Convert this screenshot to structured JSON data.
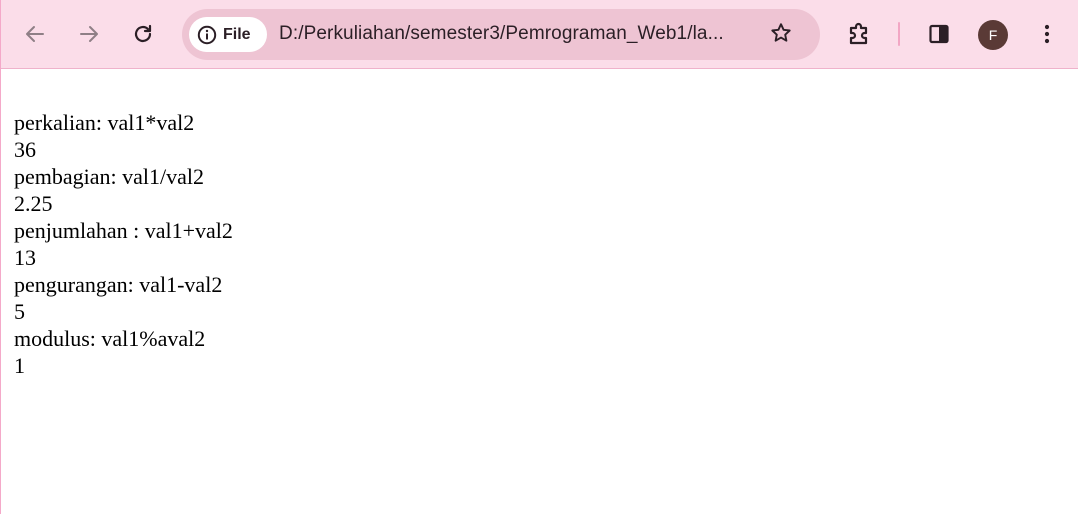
{
  "toolbar": {
    "back_icon": "arrow-left-icon",
    "forward_icon": "arrow-right-icon",
    "reload_icon": "reload-icon",
    "chip_label": "File",
    "url": "D:/Perkuliahan/semester3/Pemrograman_Web1/la...",
    "bookmark_icon": "star-icon",
    "extensions_icon": "puzzle-icon",
    "side_panel_icon": "side-panel-icon",
    "profile_initial": "F",
    "menu_icon": "kebab-menu-icon"
  },
  "page": {
    "lines": [
      "perkalian: val1*val2",
      "36",
      "pembagian: val1/val2",
      "2.25",
      "penjumlahan : val1+val2",
      "13",
      "pengurangan: val1-val2",
      "5",
      "modulus: val1%aval2",
      "1"
    ]
  },
  "colors": {
    "toolbar_bg": "#fbdde9",
    "omnibox_bg": "#eec4d3",
    "avatar_bg": "#5a3a36",
    "icon_dark": "#2b1f26",
    "icon_disabled": "#8f7f86"
  }
}
